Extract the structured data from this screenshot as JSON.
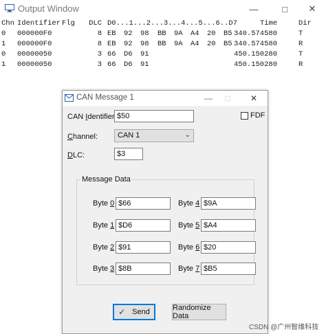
{
  "output_window": {
    "title": "Output Window",
    "icon": "monitor-icon",
    "controls": {
      "minimize": "—",
      "maximize": "□",
      "close": "✕"
    },
    "columns": {
      "chn": "Chn",
      "identifier": "Identifier",
      "flg": "Flg",
      "dlc": "DLC",
      "data": "D0...1...2...3...4...5...6..D7",
      "time": "Time",
      "dir": "Dir"
    },
    "rows": [
      {
        "chn": "0",
        "identifier": "000000F0",
        "flg": "",
        "dlc": "8",
        "bytes": [
          "EB",
          "92",
          "98",
          "BB",
          "9A",
          "A4",
          "20",
          "B5"
        ],
        "time": "340.574580",
        "dir": "T"
      },
      {
        "chn": "1",
        "identifier": "000000F0",
        "flg": "",
        "dlc": "8",
        "bytes": [
          "EB",
          "92",
          "98",
          "BB",
          "9A",
          "A4",
          "20",
          "B5"
        ],
        "time": "340.574580",
        "dir": "R"
      },
      {
        "chn": "0",
        "identifier": "00000050",
        "flg": "",
        "dlc": "3",
        "bytes": [
          "66",
          "D6",
          "91",
          "",
          "",
          "",
          "",
          ""
        ],
        "time": "450.150280",
        "dir": "T"
      },
      {
        "chn": "1",
        "identifier": "00000050",
        "flg": "",
        "dlc": "3",
        "bytes": [
          "66",
          "D6",
          "91",
          "",
          "",
          "",
          "",
          ""
        ],
        "time": "450.150280",
        "dir": "R"
      }
    ]
  },
  "can_dialog": {
    "title": "CAN Message 1",
    "icon": "envelope-icon",
    "controls": {
      "minimize": "—",
      "maximize": "□",
      "close": "✕"
    },
    "identifier": {
      "label_pre": "CAN ",
      "label_mnemonic": "I",
      "label_post": "dentifier:",
      "value": "$50"
    },
    "fdf": {
      "label": "FDF",
      "checked": false
    },
    "channel": {
      "label_mnemonic": "C",
      "label_post": "hannel:",
      "value": "CAN 1"
    },
    "dlc": {
      "label_mnemonic": "D",
      "label_post": "LC:",
      "value": "$3"
    },
    "message_data": {
      "legend": "Message Data",
      "bytes": [
        {
          "label": "Byte ",
          "num": "0",
          "value": "$66"
        },
        {
          "label": "Byte ",
          "num": "1",
          "value": "$D6"
        },
        {
          "label": "Byte ",
          "num": "2",
          "value": "$91"
        },
        {
          "label": "Byte ",
          "num": "3",
          "value": "$8B"
        },
        {
          "label": "Byte ",
          "num": "4",
          "value": "$9A"
        },
        {
          "label": "Byte ",
          "num": "5",
          "value": "$A4"
        },
        {
          "label": "Byte ",
          "num": "6",
          "value": "$20"
        },
        {
          "label": "Byte ",
          "num": "7",
          "value": "$B5"
        }
      ]
    },
    "send_button": "Send",
    "send_icon": "checkmark-icon",
    "randomize_button": "Randomize Data"
  },
  "watermark": "CSDN @广州智维科技",
  "colors": {
    "accent": "#0078d7",
    "dialog_bg": "#f0f0f0"
  }
}
